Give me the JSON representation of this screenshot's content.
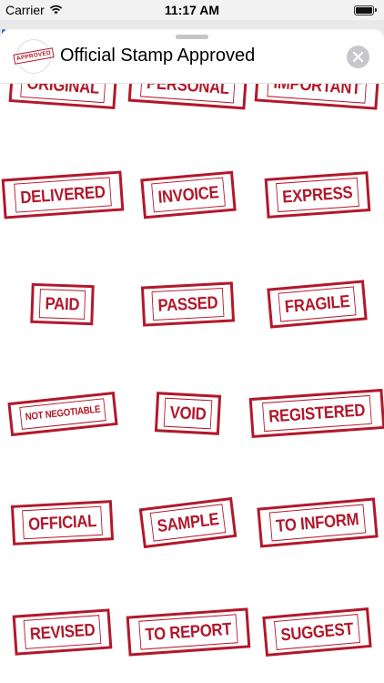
{
  "status_bar": {
    "carrier": "Carrier",
    "time": "11:17 AM",
    "wifi_icon": "wifi-icon",
    "battery_icon": "battery-icon"
  },
  "header": {
    "app_icon_text": "APPROVED",
    "title": "Official Stamp Approved",
    "close_icon": "close-icon"
  },
  "colors": {
    "stamp_red": "#b2182b",
    "close_button_bg": "#c7c7cc"
  },
  "stamps": [
    {
      "label": "ORIGINAL"
    },
    {
      "label": "PERSONAL"
    },
    {
      "label": "IMPORTANT"
    },
    {
      "label": "DELIVERED"
    },
    {
      "label": "INVOICE"
    },
    {
      "label": "EXPRESS"
    },
    {
      "label": "PAID"
    },
    {
      "label": "PASSED"
    },
    {
      "label": "FRAGILE"
    },
    {
      "label": "NOT NEGOTIABLE"
    },
    {
      "label": "VOID"
    },
    {
      "label": "REGISTERED"
    },
    {
      "label": "OFFICIAL"
    },
    {
      "label": "SAMPLE"
    },
    {
      "label": "TO INFORM"
    },
    {
      "label": "REVISED"
    },
    {
      "label": "TO REPORT"
    },
    {
      "label": "SUGGEST"
    }
  ]
}
